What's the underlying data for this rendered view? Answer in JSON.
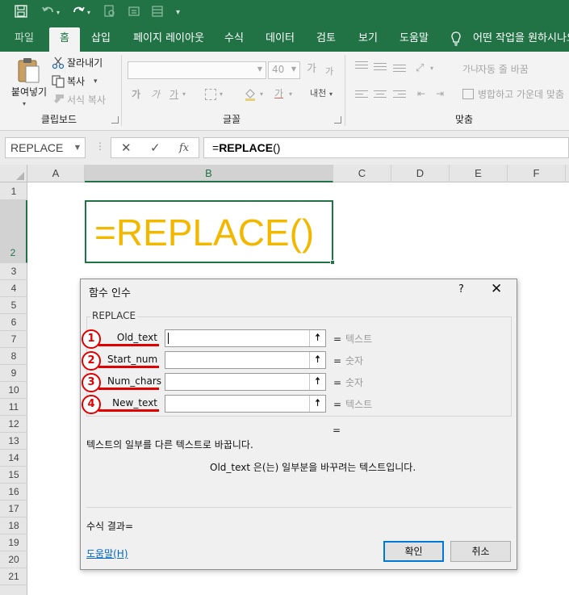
{
  "quick_access": {
    "icons": [
      "save-icon",
      "undo-icon",
      "redo-icon",
      "print-preview-icon",
      "touch-mode-icon",
      "form-icon",
      "customize-icon"
    ]
  },
  "ribbon_tabs": {
    "file": "파일",
    "home": "홈",
    "insert": "삽입",
    "page_layout": "페이지 레이아웃",
    "formulas": "수식",
    "data": "데이터",
    "review": "검토",
    "view": "보기",
    "help": "도움말",
    "tell_me": "어떤 작업을 원하시나요"
  },
  "clipboard": {
    "paste": "붙여넣기",
    "cut": "잘라내기",
    "copy": "복사",
    "format_painter": "서식 복사",
    "group_label": "클립보드"
  },
  "font": {
    "size_value": "40",
    "grow": "가",
    "shrink": "가",
    "bold": "가",
    "italic": "가",
    "underline": "가",
    "font_color": "가",
    "phonetic": "내천",
    "group_label": "글꼴"
  },
  "alignment": {
    "wrap_text": "자동 줄 바꿈",
    "merge_center": "병합하고 가운데 맞춤",
    "group_label": "맞춤",
    "wrap_icon_text": "가나"
  },
  "formula_bar": {
    "name_box": "REPLACE",
    "cancel_icon": "✕",
    "enter_icon": "✓",
    "fx_label": "fx",
    "formula_prefix": "=",
    "formula_fn": "REPLACE",
    "formula_suffix": "()"
  },
  "columns": [
    "A",
    "B",
    "C",
    "D",
    "E",
    "F"
  ],
  "rows": [
    "1",
    "2",
    "3",
    "4",
    "5",
    "6",
    "7",
    "8",
    "9",
    "10",
    "11",
    "12",
    "13",
    "14",
    "15",
    "16",
    "17",
    "18",
    "19",
    "20",
    "21"
  ],
  "active_cell": {
    "text": "=REPLACE()",
    "color": "#f2b800"
  },
  "dialog": {
    "title": "함수 인수",
    "help_glyph": "?",
    "close_glyph": "✕",
    "function_name": "REPLACE",
    "args": [
      {
        "marker": "1",
        "label": "Old_text",
        "value": "",
        "hint": "텍스트"
      },
      {
        "marker": "2",
        "label": "Start_num",
        "value": "",
        "hint": "숫자"
      },
      {
        "marker": "3",
        "label": "Num_chars",
        "value": "",
        "hint": "숫자"
      },
      {
        "marker": "4",
        "label": "New_text",
        "value": "",
        "hint": "텍스트"
      }
    ],
    "equals": "=",
    "collapse_glyph": "🠅",
    "result_equals": "=",
    "description": "텍스트의 일부를 다른 텍스트로 바꿉니다.",
    "arg_description": "Old_text  은(는) 일부분을 바꾸려는 텍스트입니다.",
    "formula_result": "수식 결과=",
    "help_link": "도움말(H)",
    "ok": "확인",
    "cancel": "취소"
  },
  "colors": {
    "excel_green": "#217346",
    "marker_red": "#e00000",
    "link_blue": "#0066cc"
  }
}
